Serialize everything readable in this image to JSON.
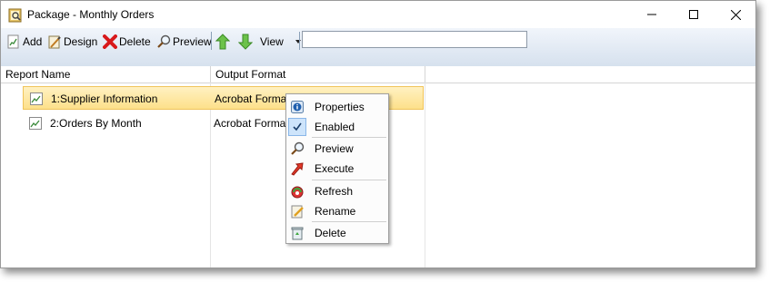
{
  "window": {
    "title": "Package - Monthly Orders",
    "icons": {
      "app": "package-magnifier-icon",
      "minimize": "minimize-icon",
      "maximize": "maximize-icon",
      "close": "close-icon"
    }
  },
  "toolbar": {
    "add_label": "Add",
    "design_label": "Design",
    "delete_label": "Delete",
    "preview_label": "Preview",
    "view_label": "View",
    "search_value": "",
    "icons": [
      "add-report-icon",
      "design-icon",
      "delete-x-icon",
      "preview-magnifier-icon",
      "move-up-arrow-icon",
      "move-down-arrow-icon",
      "dropdown-arrow-icon"
    ]
  },
  "table": {
    "columns": [
      "Report Name",
      "Output Format"
    ],
    "rows": [
      {
        "name": "1:Supplier Information",
        "format": "Acrobat Format",
        "selected": true
      },
      {
        "name": "2:Orders By Month",
        "format": "Acrobat Format",
        "selected": false
      }
    ]
  },
  "context_menu": {
    "items": [
      {
        "label": "Properties",
        "icon": "info-icon"
      },
      {
        "label": "Enabled",
        "icon": "check-icon",
        "checked": true
      },
      {
        "label": "Preview",
        "icon": "magnifier-icon"
      },
      {
        "label": "Execute",
        "icon": "execute-arrow-icon"
      },
      {
        "label": "Refresh",
        "icon": "refresh-icon"
      },
      {
        "label": "Rename",
        "icon": "rename-pencil-icon"
      },
      {
        "label": "Delete",
        "icon": "recycle-bin-icon"
      }
    ]
  },
  "colors": {
    "toolbar_top": "#f1f5fb",
    "toolbar_bottom": "#d6e1ee",
    "selection": "#fde08a",
    "menu_bg": "#fcfcfc"
  }
}
